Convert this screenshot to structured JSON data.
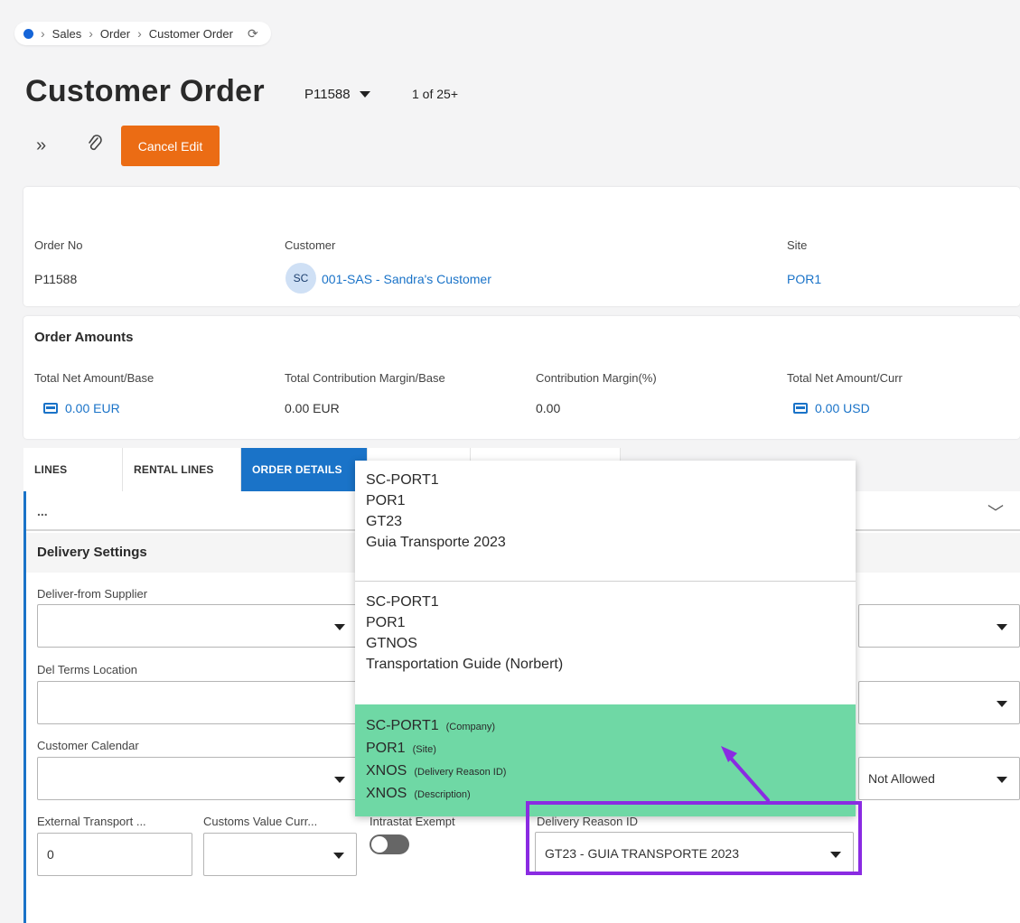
{
  "breadcrumb": {
    "items": [
      "Sales",
      "Order",
      "Customer Order"
    ]
  },
  "header": {
    "title": "Customer Order",
    "order_id": "P11588",
    "record_count": "1 of 25+"
  },
  "toolbar": {
    "cancel_label": "Cancel Edit"
  },
  "order_card": {
    "order_no_label": "Order No",
    "order_no": "P11588",
    "customer_label": "Customer",
    "customer_initials": "SC",
    "customer": "001-SAS - Sandra's Customer",
    "site_label": "Site",
    "site": "POR1"
  },
  "amounts": {
    "title": "Order Amounts",
    "net_base_label": "Total Net Amount/Base",
    "net_base": "0.00 EUR",
    "margin_base_label": "Total Contribution Margin/Base",
    "margin_base": "0.00 EUR",
    "margin_pct_label": "Contribution Margin(%)",
    "margin_pct": "0.00",
    "net_curr_label": "Total Net Amount/Curr",
    "net_curr": "0.00 USD"
  },
  "tabs": [
    "LINES",
    "RENTAL LINES",
    "ORDER DETAILS"
  ],
  "details": {
    "ellipsis": "...",
    "section_title": "Delivery Settings",
    "deliver_from_label": "Deliver-from Supplier",
    "del_terms_label": "Del Terms Location",
    "calendar_label": "Customer Calendar",
    "not_allowed_value": "Not Allowed",
    "ext_transport_label": "External Transport ...",
    "ext_transport_value": "0",
    "customs_curr_label": "Customs Value Curr...",
    "intrastat_label": "Intrastat Exempt",
    "delivery_reason_label": "Delivery Reason ID",
    "delivery_reason_value": "GT23 - GUIA TRANSPORTE 2023"
  },
  "dropdown": {
    "option1": [
      "SC-PORT1",
      "POR1",
      "GT23",
      "Guia Transporte 2023"
    ],
    "option2": [
      "SC-PORT1",
      "POR1",
      "GTNOS",
      "Transportation Guide (Norbert)"
    ],
    "option3": [
      {
        "value": "SC-PORT1",
        "hint": "(Company)"
      },
      {
        "value": "POR1",
        "hint": "(Site)"
      },
      {
        "value": "XNOS",
        "hint": "(Delivery Reason ID)"
      },
      {
        "value": "XNOS",
        "hint": "(Description)"
      }
    ]
  },
  "colors": {
    "accent": "#1a73c8",
    "cancel_button": "#eb6c14",
    "highlight_option": "#6fd8a5",
    "annotation": "#8a2be2"
  }
}
